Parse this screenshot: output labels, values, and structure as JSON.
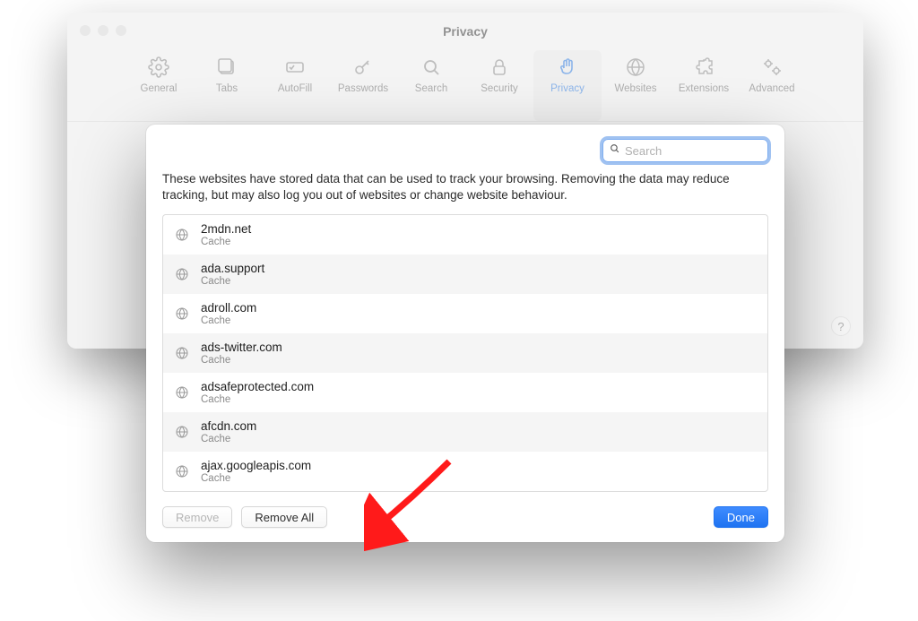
{
  "window": {
    "title": "Privacy",
    "help_symbol": "?"
  },
  "toolbar": {
    "items": [
      {
        "key": "general",
        "label": "General"
      },
      {
        "key": "tabs",
        "label": "Tabs"
      },
      {
        "key": "autofill",
        "label": "AutoFill"
      },
      {
        "key": "passwords",
        "label": "Passwords"
      },
      {
        "key": "search",
        "label": "Search"
      },
      {
        "key": "security",
        "label": "Security"
      },
      {
        "key": "privacy",
        "label": "Privacy",
        "active": true
      },
      {
        "key": "websites",
        "label": "Websites"
      },
      {
        "key": "extensions",
        "label": "Extensions"
      },
      {
        "key": "advanced",
        "label": "Advanced"
      }
    ]
  },
  "modal": {
    "search_placeholder": "Search",
    "description": "These websites have stored data that can be used to track your browsing. Removing the data may reduce tracking, but may also log you out of websites or change website behaviour.",
    "sites": [
      {
        "domain": "2mdn.net",
        "detail": "Cache"
      },
      {
        "domain": "ada.support",
        "detail": "Cache"
      },
      {
        "domain": "adroll.com",
        "detail": "Cache"
      },
      {
        "domain": "ads-twitter.com",
        "detail": "Cache"
      },
      {
        "domain": "adsafeprotected.com",
        "detail": "Cache"
      },
      {
        "domain": "afcdn.com",
        "detail": "Cache"
      },
      {
        "domain": "ajax.googleapis.com",
        "detail": "Cache"
      }
    ],
    "buttons": {
      "remove": "Remove",
      "remove_all": "Remove All",
      "done": "Done"
    }
  }
}
